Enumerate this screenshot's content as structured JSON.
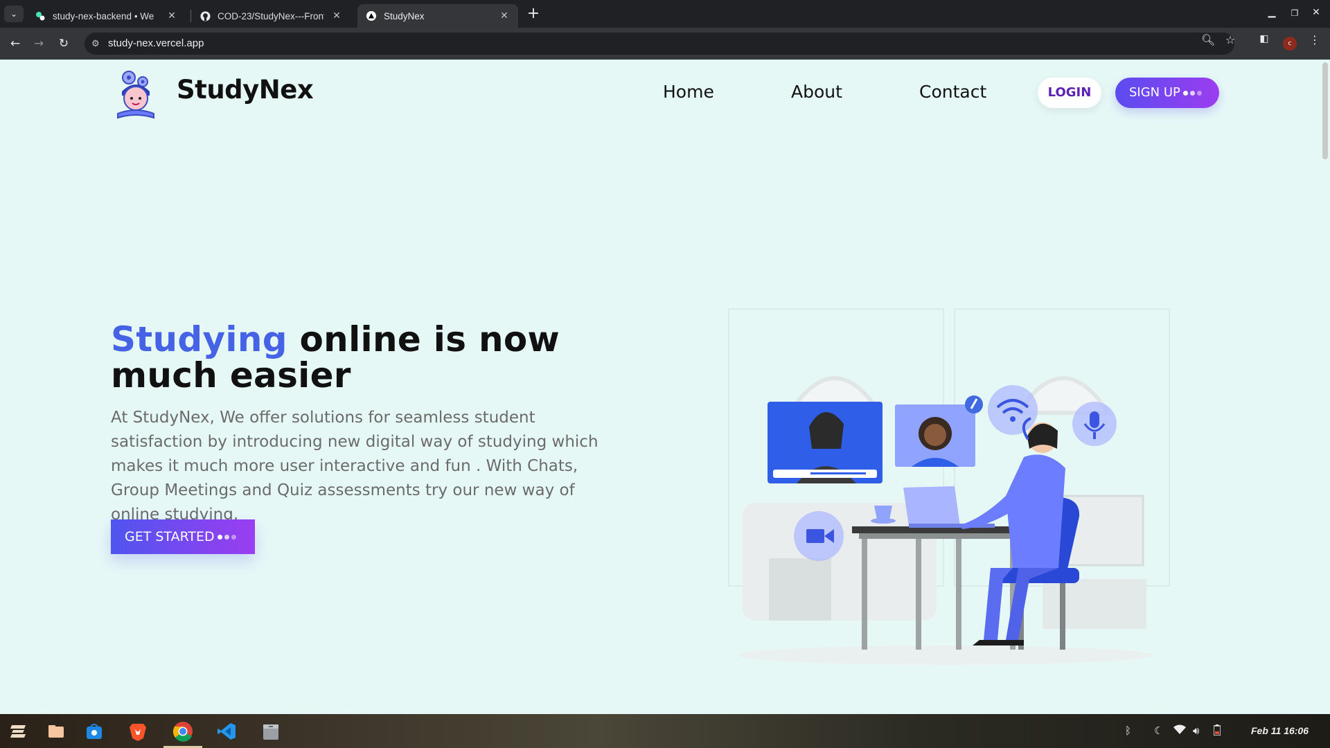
{
  "browser": {
    "tabs": [
      {
        "title": "study-nex-backend • We",
        "icon": "deploy-service-icon",
        "active": false
      },
      {
        "title": "COD-23/StudyNex---Front",
        "icon": "github-icon",
        "active": false
      },
      {
        "title": "StudyNex",
        "icon": "vercel-triangle-icon",
        "active": true
      }
    ],
    "url": "study-nex.vercel.app"
  },
  "header": {
    "brand": "StudyNex",
    "nav": [
      "Home",
      "About",
      "Contact"
    ],
    "login_label": "LOGIN",
    "signup_label": "SIGN UP"
  },
  "hero": {
    "title_accent": "Studying",
    "title_rest": " online is now much easier",
    "description": "At StudyNex, We offer solutions for seamless student satisfaction by introducing new digital way of studying which makes it much more user interactive and fun . With Chats, Group Meetings and Quiz assessments try our new way of online studying.",
    "cta_label": "GET STARTED"
  },
  "colors": {
    "page_bg": "#e6f8f6",
    "accent": "#4563e4",
    "button_gradient_start": "#4f55ef",
    "button_gradient_end": "#9b3df0",
    "login_text": "#5b21b6"
  },
  "taskbar": {
    "apps": [
      "zorin-menu-icon",
      "files-icon",
      "software-store-icon",
      "brave-icon",
      "chrome-icon",
      "vscode-icon",
      "archive-icon"
    ],
    "tray": [
      "bluetooth-icon",
      "night-light-icon",
      "wifi-icon",
      "volume-icon",
      "battery-icon"
    ],
    "clock": "Feb 11  16:06"
  }
}
